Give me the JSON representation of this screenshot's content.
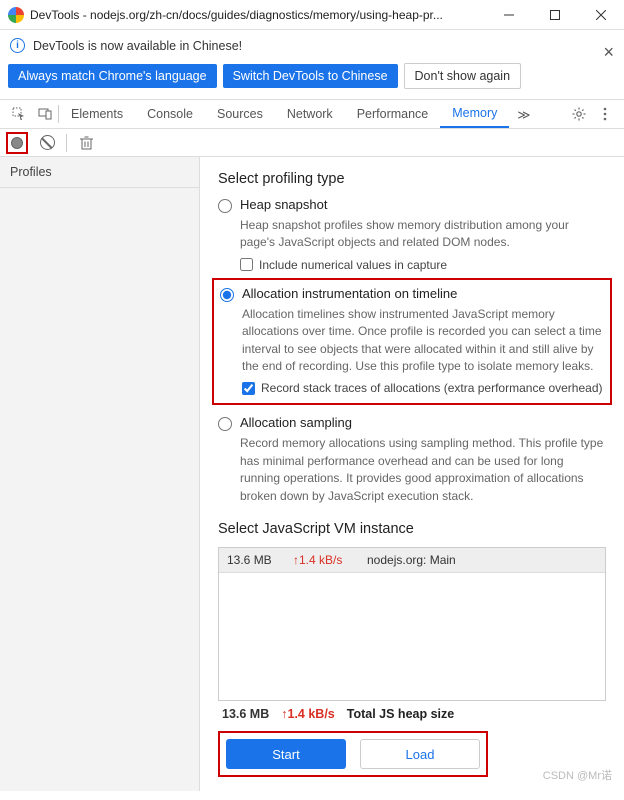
{
  "window": {
    "title": "DevTools - nodejs.org/zh-cn/docs/guides/diagnostics/memory/using-heap-pr..."
  },
  "infobar": {
    "message": "DevTools is now available in Chinese!",
    "btn_match": "Always match Chrome's language",
    "btn_switch": "Switch DevTools to Chinese",
    "btn_dismiss": "Don't show again"
  },
  "tabs": {
    "elements": "Elements",
    "console": "Console",
    "sources": "Sources",
    "network": "Network",
    "performance": "Performance",
    "memory": "Memory"
  },
  "sidebar": {
    "header": "Profiles"
  },
  "profiling": {
    "heading": "Select profiling type",
    "heap": {
      "label": "Heap snapshot",
      "desc": "Heap snapshot profiles show memory distribution among your page's JavaScript objects and related DOM nodes.",
      "chk": "Include numerical values in capture"
    },
    "timeline": {
      "label": "Allocation instrumentation on timeline",
      "desc": "Allocation timelines show instrumented JavaScript memory allocations over time. Once profile is recorded you can select a time interval to see objects that were allocated within it and still alive by the end of recording. Use this profile type to isolate memory leaks.",
      "chk": "Record stack traces of allocations (extra performance overhead)"
    },
    "sampling": {
      "label": "Allocation sampling",
      "desc": "Record memory allocations using sampling method. This profile type has minimal performance overhead and can be used for long running operations. It provides good approximation of allocations broken down by JavaScript execution stack."
    }
  },
  "vm": {
    "heading": "Select JavaScript VM instance",
    "row": {
      "size": "13.6 MB",
      "rate": "↑1.4 kB/s",
      "name": "nodejs.org: Main"
    }
  },
  "totals": {
    "size": "13.6 MB",
    "rate": "↑1.4 kB/s",
    "label": "Total JS heap size"
  },
  "buttons": {
    "start": "Start",
    "load": "Load"
  },
  "watermark": "CSDN @Mr诺"
}
